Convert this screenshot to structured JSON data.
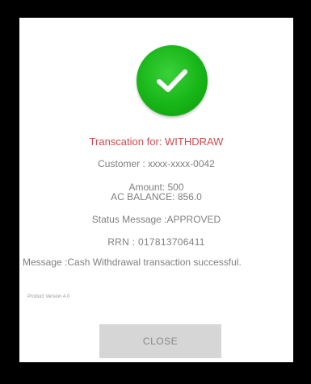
{
  "dialog": {
    "title": "Transcation for: WITHDRAW",
    "customer": "Customer : xxxx-xxxx-0042",
    "amount": "Amount: 500",
    "balance": "AC BALANCE: 856.0",
    "status": "Status Message :APPROVED",
    "rrn": "RRN : 017813706411",
    "message": "Message :Cash Withdrawal transaction successful.",
    "version": "Product Version 4.0",
    "close_label": "CLOSE"
  },
  "icons": {
    "status": "check-icon"
  },
  "colors": {
    "success_green": "#17b517",
    "title_red": "#d5484d",
    "button_gray": "#d6d6d6"
  }
}
